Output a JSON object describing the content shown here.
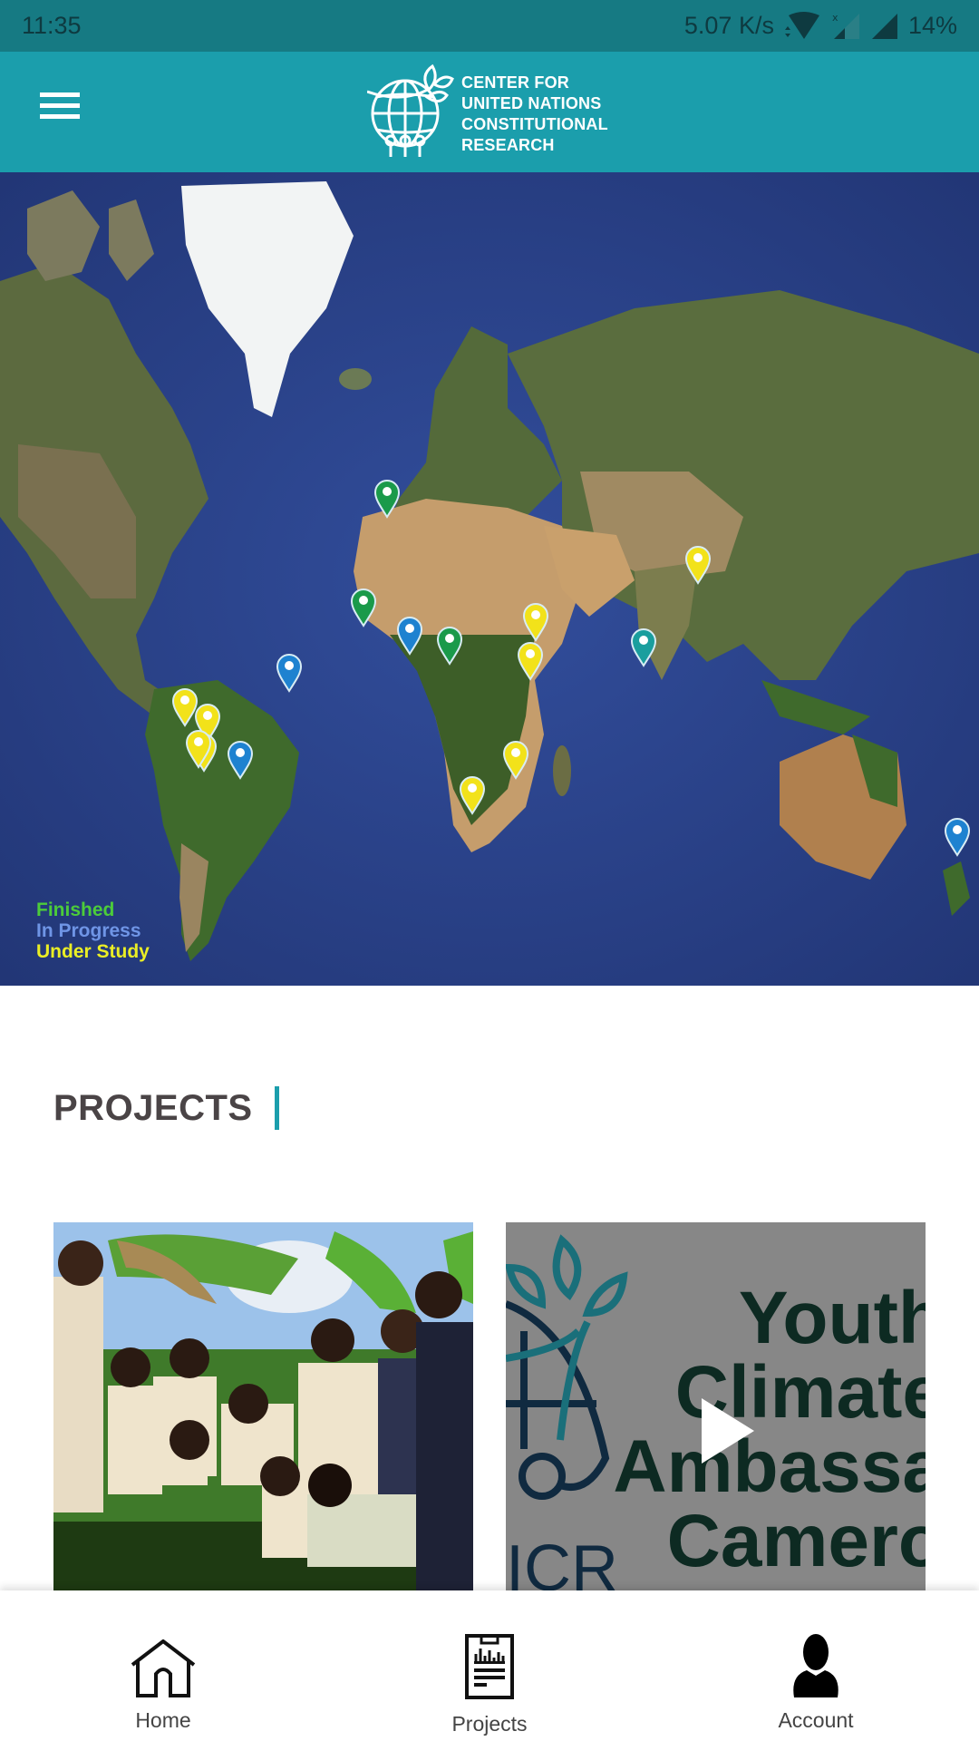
{
  "status_bar": {
    "time": "11:35",
    "network_speed": "5.07 K/s",
    "battery": "14%",
    "icons": [
      "wifi-icon",
      "signal-no-sim-icon",
      "signal-icon"
    ]
  },
  "app_bar": {
    "menu_icon": "hamburger-menu-icon",
    "logo_lines": [
      "CENTER FOR",
      "UNITED NATIONS",
      "CONSTITUTIONAL",
      "RESEARCH"
    ],
    "brand_color": "#1b9eac"
  },
  "map": {
    "legend": {
      "finished": "Finished",
      "in_progress": "In Progress",
      "under_study": "Under Study"
    },
    "status_colors": {
      "finished": "#1a9a4a",
      "in_progress": "#1e82d0",
      "under_study": "#f2e21a",
      "other": "#1a9e9e"
    },
    "markers": [
      {
        "region": "Portugal",
        "status": "finished"
      },
      {
        "region": "Senegal",
        "status": "finished"
      },
      {
        "region": "Ghana",
        "status": "in_progress"
      },
      {
        "region": "Cameroon",
        "status": "finished"
      },
      {
        "region": "Ethiopia",
        "status": "under_study"
      },
      {
        "region": "Kenya",
        "status": "under_study"
      },
      {
        "region": "Mozambique",
        "status": "under_study"
      },
      {
        "region": "South Africa",
        "status": "under_study"
      },
      {
        "region": "Maldives",
        "status": "other"
      },
      {
        "region": "Bangladesh",
        "status": "under_study"
      },
      {
        "region": "Peru",
        "status": "under_study"
      },
      {
        "region": "Bolivia 1",
        "status": "under_study"
      },
      {
        "region": "Bolivia 2",
        "status": "under_study"
      },
      {
        "region": "Bolivia 3",
        "status": "under_study"
      },
      {
        "region": "Paraguay",
        "status": "in_progress"
      },
      {
        "region": "Brazil",
        "status": "in_progress"
      },
      {
        "region": "New Zealand",
        "status": "in_progress"
      }
    ]
  },
  "projects": {
    "heading": "PROJECTS",
    "cards": [
      {
        "type": "image",
        "alt": "Students planting a tree among banana plants"
      },
      {
        "type": "video",
        "title_lines": [
          "Youth",
          "Climate",
          "Ambassa",
          "Camero"
        ],
        "logo_text": "ICR"
      }
    ]
  },
  "bottom_nav": {
    "items": [
      {
        "label": "Home",
        "icon": "home-icon"
      },
      {
        "label": "Projects",
        "icon": "projects-report-icon"
      },
      {
        "label": "Account",
        "icon": "account-person-icon"
      }
    ]
  }
}
